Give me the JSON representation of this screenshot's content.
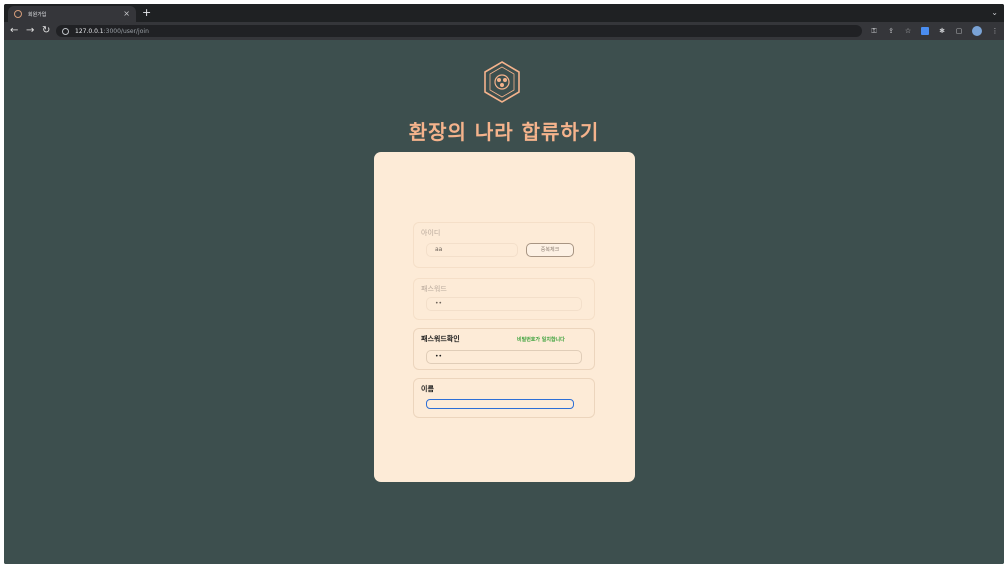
{
  "browser": {
    "tab_title": "회원가입",
    "tab_close": "×",
    "new_tab": "+",
    "tab_menu": "⌄",
    "url_host": "127.0.0.1",
    "url_rest": ":3000/user/join"
  },
  "page": {
    "title": "환장의 나라 합류하기",
    "fields": [
      {
        "label": "아이디",
        "value": "aa",
        "button_label": "중복체크"
      },
      {
        "label": "패스워드",
        "value": "••"
      },
      {
        "label": "패스워드확인",
        "value": "••",
        "message": "비밀번호가 일치합니다"
      },
      {
        "label": "이름",
        "value": ""
      }
    ]
  },
  "colors": {
    "background": "#3d4f4e",
    "card": "#fdebd7",
    "title": "#f5b38c",
    "match": "#3aa13a",
    "focus": "#2e6fd6"
  }
}
